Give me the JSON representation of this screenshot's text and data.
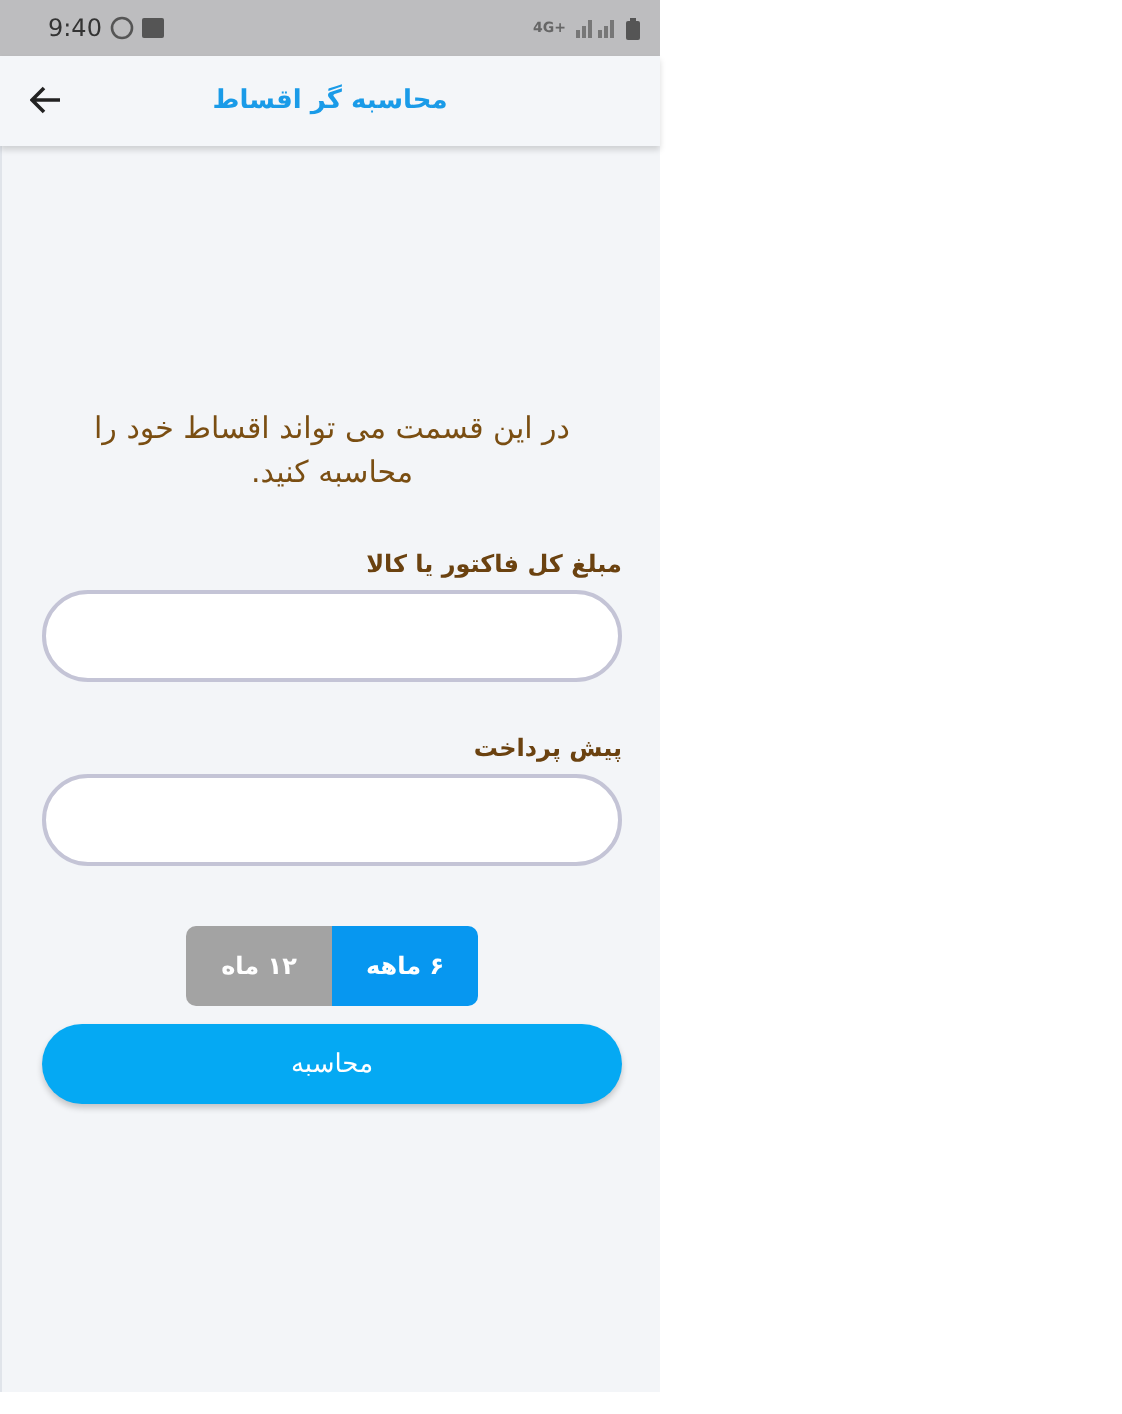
{
  "status_bar": {
    "time": "9:40",
    "network": "4G+"
  },
  "app_bar": {
    "title": "محاسبه گر اقساط"
  },
  "intro": "در این قسمت می تواند اقساط خود را محاسبه کنید.",
  "fields": [
    {
      "label": "مبلغ کل فاکتور یا کالا"
    },
    {
      "label": "پیش پرداخت"
    }
  ],
  "periods": [
    {
      "label": "۶ ماهه",
      "selected": true
    },
    {
      "label": "۱۲ ماه",
      "selected": false
    }
  ],
  "submit": "محاسبه"
}
